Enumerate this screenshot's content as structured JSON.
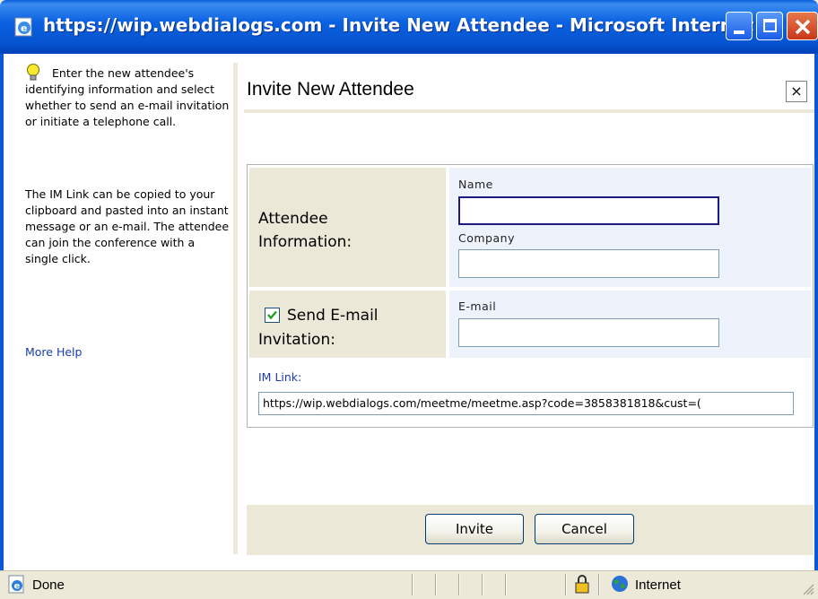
{
  "window": {
    "title": "https://wip.webdialogs.com - Invite New Attendee - Microsoft Internet ...",
    "buttons": [
      "minimize",
      "maximize",
      "close"
    ]
  },
  "help": {
    "icon": "lightbulb-icon",
    "paragraph1": "Enter the new attendee's identifying information and select whether to send an e-mail invitation or initiate a telephone call.",
    "paragraph2": "The IM Link can be copied to your clipboard and pasted into an instant message or an e-mail. The attendee can join the conference with a single click.",
    "more_help": "More Help"
  },
  "dialog": {
    "title": "Invite New Attendee",
    "close_glyph": "×"
  },
  "form": {
    "attendee_section_label_1": "Attendee",
    "attendee_section_label_2": "Information:",
    "name_label": "Name",
    "name_value": "",
    "company_label": "Company",
    "company_value": "",
    "email_checkbox_checked": true,
    "email_section_label_1": "Send E-mail",
    "email_section_label_2": "Invitation:",
    "email_label": "E-mail",
    "email_value": "",
    "im_link_label": "IM Link:",
    "im_link_value": "https://wip.webdialogs.com/meetme/meetme.asp?code=3858381818&cust=("
  },
  "actions": {
    "invite": "Invite",
    "cancel": "Cancel"
  },
  "statusbar": {
    "status": "Done",
    "zone": "Internet"
  },
  "colors": {
    "titlebar": "#0a5fd8",
    "link": "#1a3cb0",
    "label_cell": "#ebe8d8",
    "field_cell": "#eef3fb"
  }
}
